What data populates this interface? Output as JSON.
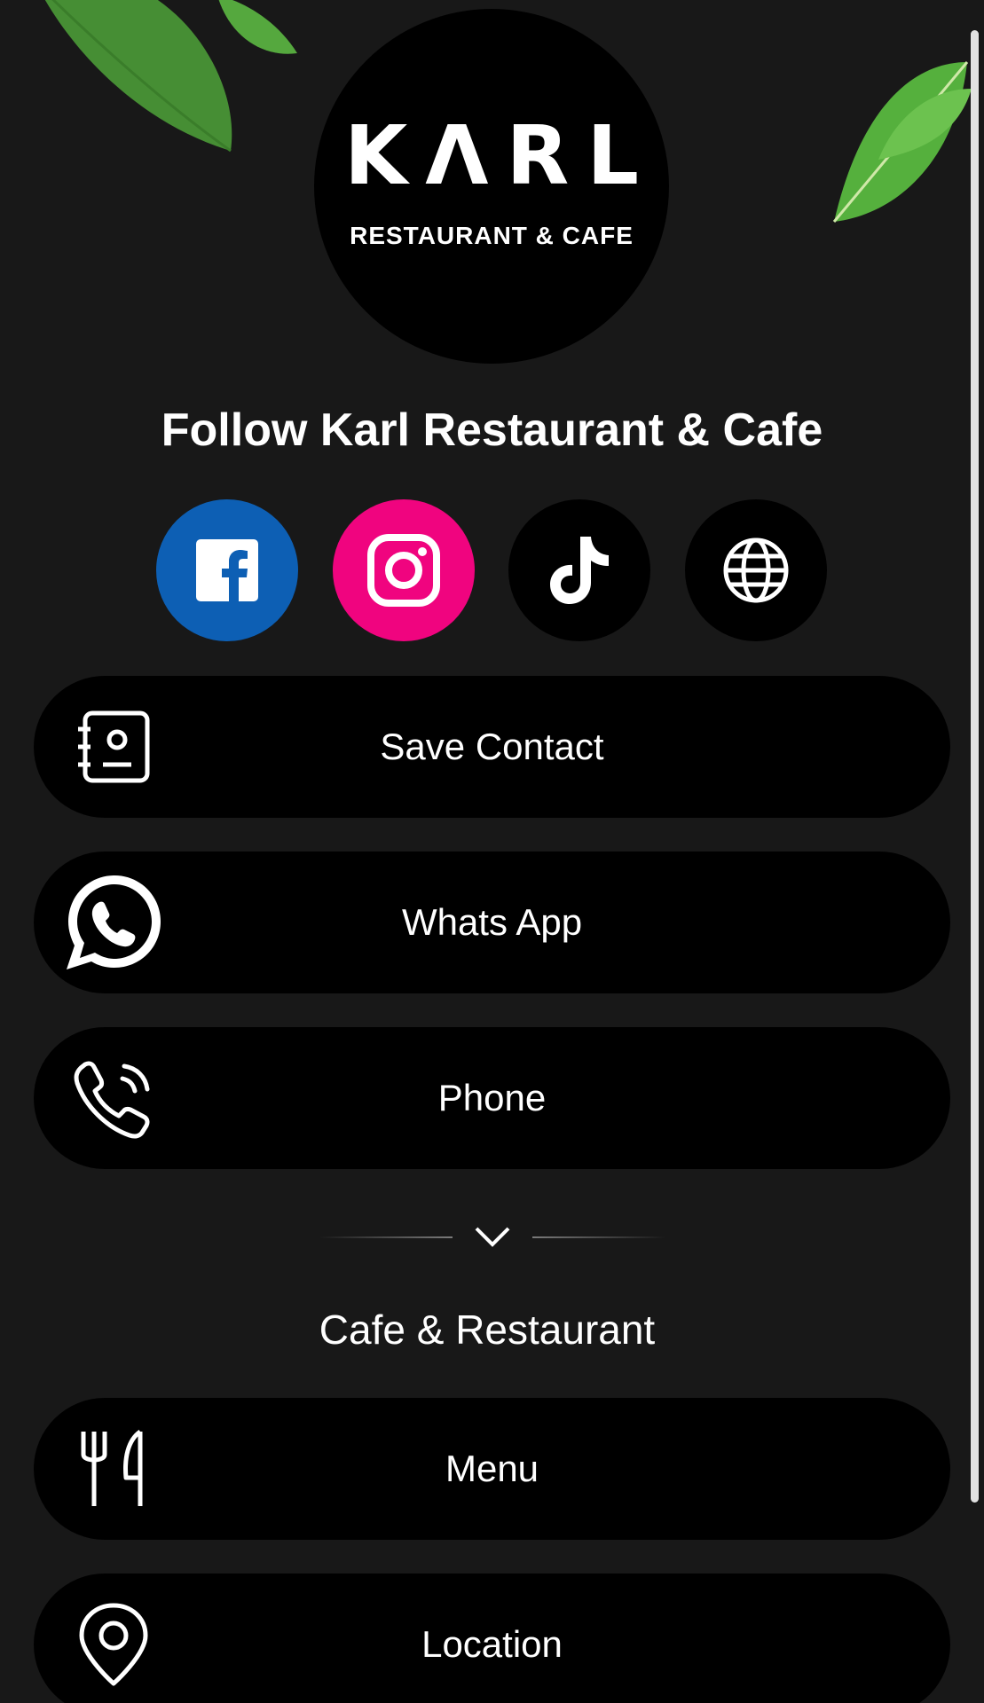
{
  "logo": {
    "brand": "KΛRL",
    "subtitle": "RESTAURANT & CAFE"
  },
  "follow_title": "Follow Karl Restaurant & Cafe",
  "social": [
    {
      "name": "facebook",
      "icon": "facebook-icon",
      "color": "#0d5fb4"
    },
    {
      "name": "instagram",
      "icon": "instagram-icon",
      "color": "#f0047f"
    },
    {
      "name": "tiktok",
      "icon": "tiktok-icon",
      "color": "#000000"
    },
    {
      "name": "website",
      "icon": "globe-icon",
      "color": "#000000"
    }
  ],
  "buttons": {
    "save_contact": {
      "label": "Save Contact",
      "icon": "contact-book-icon"
    },
    "whatsapp": {
      "label": "Whats App",
      "icon": "whatsapp-icon"
    },
    "phone": {
      "label": "Phone",
      "icon": "phone-icon"
    },
    "menu": {
      "label": "Menu",
      "icon": "fork-knife-icon"
    },
    "location": {
      "label": "Location",
      "icon": "location-pin-icon"
    }
  },
  "section": {
    "title": "Cafe & Restaurant"
  },
  "colors": {
    "background": "#181818",
    "button": "#000000",
    "text": "#ffffff"
  }
}
